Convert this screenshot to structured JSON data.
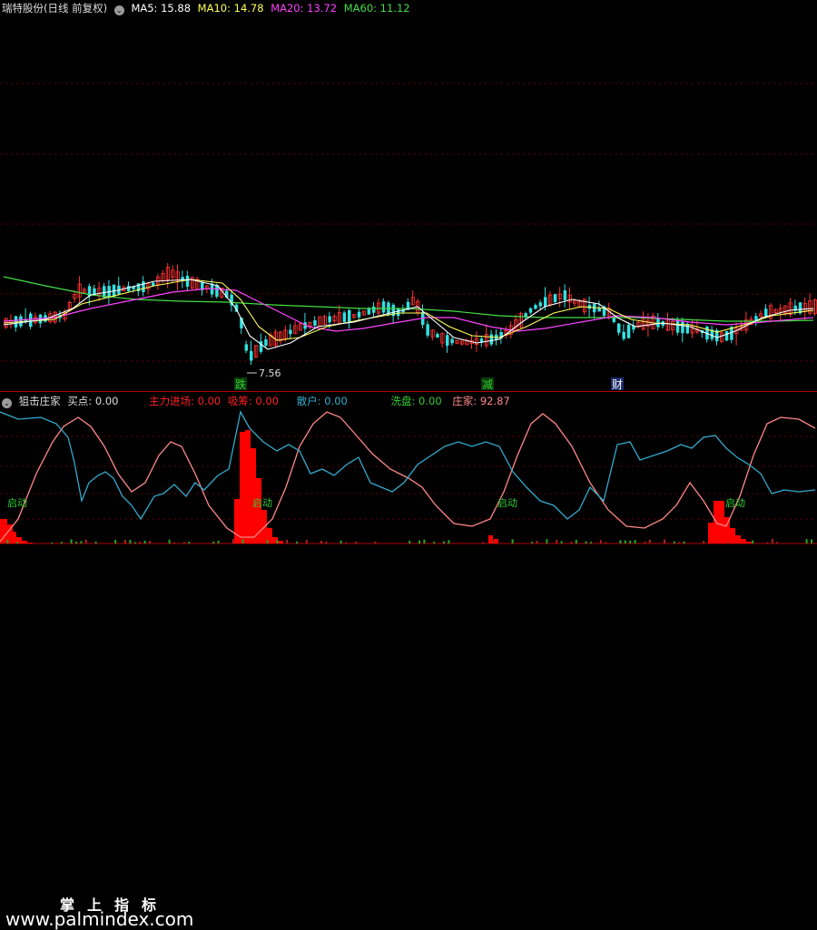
{
  "main_header": {
    "stock": "瑞特股份(日线 前复权)",
    "ma5": "MA5: 15.88",
    "ma10": "MA10: 14.78",
    "ma20": "MA20: 13.72",
    "ma60": "MA60: 11.12",
    "colors": {
      "ma5": "#ffffff",
      "ma10": "#ffff55",
      "ma20": "#ff44ff",
      "ma60": "#44dd44"
    }
  },
  "annotations": {
    "low_price": "7.56",
    "markers": [
      {
        "label": "跌",
        "color": "#33cc33",
        "bg": "#0a3a0a"
      },
      {
        "label": "减",
        "color": "#33cc33",
        "bg": "#0a3a0a"
      },
      {
        "label": "财",
        "color": "#ffffff",
        "bg": "#1a2a6a"
      }
    ]
  },
  "indicator_header": {
    "name": "狙击庄家",
    "buy": "买点: 0.00",
    "main_force": "主力进场: 0.00",
    "absorb": "吸筹: 0.00",
    "retail": "散户: 0.00",
    "wash": "洗盘: 0.00",
    "banker": "庄家: 92.87",
    "colors": {
      "name": "#dddddd",
      "main_force": "#ff2222",
      "retail": "#33aacc",
      "wash": "#33cc33",
      "banker": "#ff8888"
    }
  },
  "indicator_labels": {
    "start": "启动"
  },
  "watermark": {
    "line1": "掌上指标",
    "line2": "www.palmindex.com"
  },
  "chart_data": {
    "type": "candlestick",
    "ma_lines": [
      "MA5",
      "MA10",
      "MA20",
      "MA60"
    ],
    "indicator_series": [
      "散户",
      "庄家",
      "主力进场"
    ]
  }
}
